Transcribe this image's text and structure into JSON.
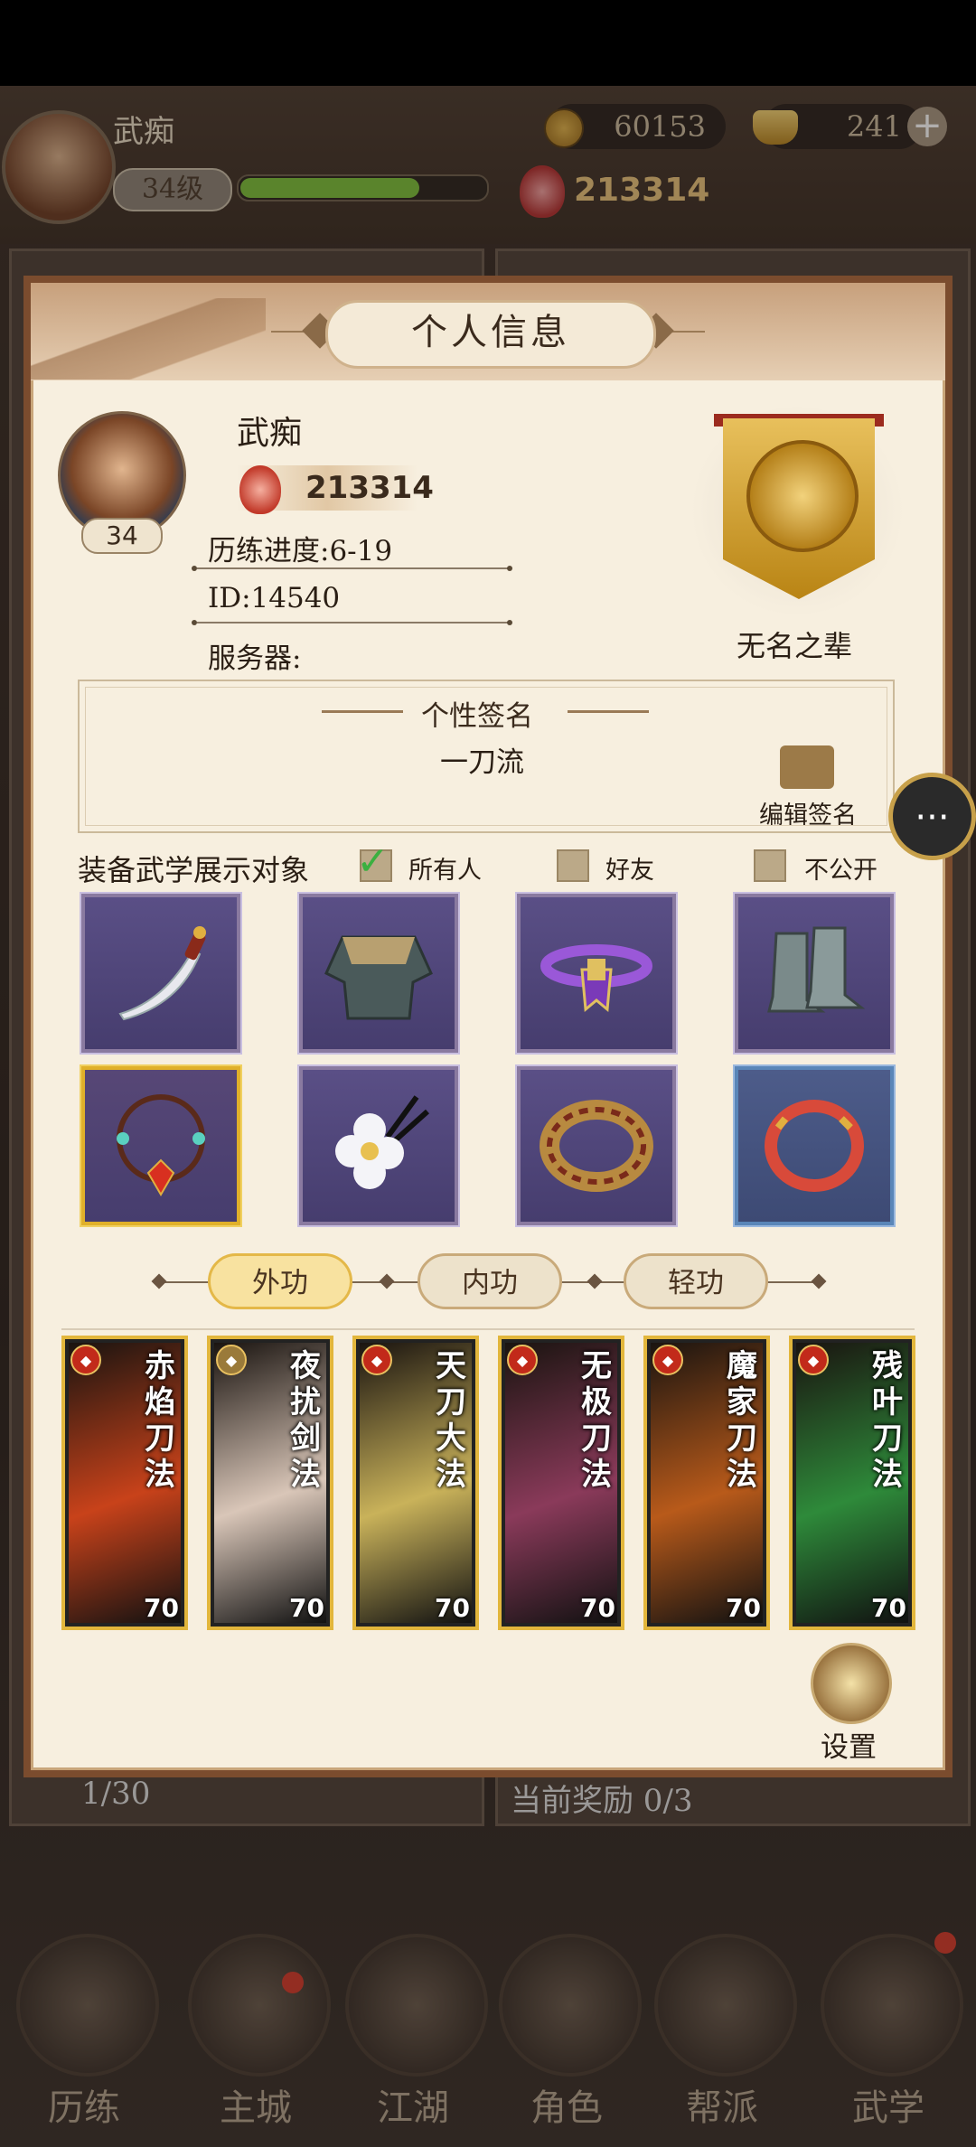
{
  "hud": {
    "player_name": "武痴",
    "level": "34级",
    "xp_fraction": 0.73,
    "coins": "60153",
    "ingots": "241",
    "power": "213314"
  },
  "background": {
    "panel_left_progress": "1/30",
    "panel_right_reward": "当前奖励 0/3"
  },
  "nav": [
    {
      "label": "历练"
    },
    {
      "label": "主城"
    },
    {
      "label": "江湖"
    },
    {
      "label": "角色"
    },
    {
      "label": "帮派"
    },
    {
      "label": "武学"
    }
  ],
  "modal": {
    "title": "个人信息",
    "profile": {
      "name": "武痴",
      "level": "34",
      "power": "213314",
      "progress": "历练进度:6-19",
      "id": "ID:14540",
      "server": "服务器:"
    },
    "rank_title": "无名之辈",
    "signature": {
      "heading": "个性签名",
      "text": "一刀流",
      "edit_label": "编辑签名"
    },
    "visibility": {
      "label": "装备武学展示对象",
      "options": [
        {
          "label": "所有人",
          "checked": true
        },
        {
          "label": "好友",
          "checked": false
        },
        {
          "label": "不公开",
          "checked": false
        }
      ]
    },
    "equipment": [
      {
        "icon": "saber-icon",
        "frame": "purple"
      },
      {
        "icon": "armor-icon",
        "frame": "purple"
      },
      {
        "icon": "belt-icon",
        "frame": "purple"
      },
      {
        "icon": "boots-icon",
        "frame": "purple"
      },
      {
        "icon": "necklace-icon",
        "frame": "gold"
      },
      {
        "icon": "hairpin-icon",
        "frame": "purple"
      },
      {
        "icon": "ring-icon",
        "frame": "purple"
      },
      {
        "icon": "bracelet-icon",
        "frame": "blue"
      }
    ],
    "tabs": [
      {
        "label": "外功",
        "active": true
      },
      {
        "label": "内功",
        "active": false
      },
      {
        "label": "轻功",
        "active": false
      }
    ],
    "skills": [
      {
        "name": "赤焰刀法",
        "level": "70",
        "color": "#c8421a"
      },
      {
        "name": "夜扰剑法",
        "level": "70",
        "color": "#d9c6b8"
      },
      {
        "name": "天刀大法",
        "level": "70",
        "color": "#c9b25a"
      },
      {
        "name": "无极刀法",
        "level": "70",
        "color": "#8a3a5a"
      },
      {
        "name": "魔家刀法",
        "level": "70",
        "color": "#b85a1a"
      },
      {
        "name": "残叶刀法",
        "level": "70",
        "color": "#2e8a3a"
      }
    ],
    "settings_label": "设置"
  }
}
